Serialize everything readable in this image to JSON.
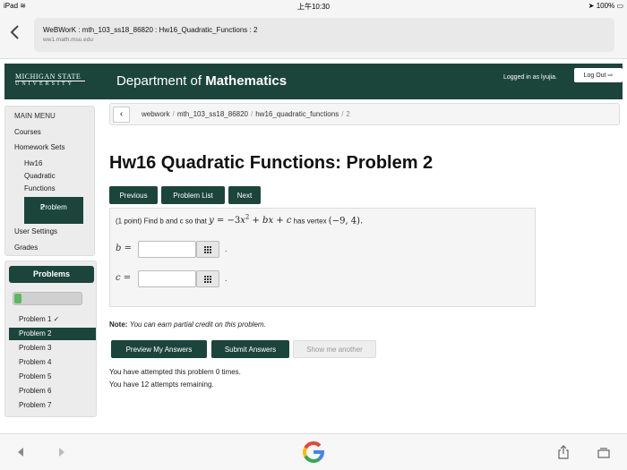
{
  "status_bar": {
    "device": "iPad",
    "time": "上午10:30",
    "battery": "100%"
  },
  "browser": {
    "page_title": "WeBWorK : mth_103_ss18_86820 : Hw16_Quadratic_Functions : 2",
    "url": "ww1.math.msu.edu"
  },
  "header": {
    "logo_line1": "MICHIGAN STATE",
    "logo_line2": "UNIVERSITY",
    "dept_prefix": "Department of ",
    "dept_bold": "Mathematics",
    "logged_in": "Logged in as lyujia.",
    "logout": "Log Out"
  },
  "menu": {
    "heading": "MAIN MENU",
    "courses": "Courses",
    "homework_sets": "Homework Sets",
    "set_name_line1": "Hw16",
    "set_name_line2": "Quadratic",
    "set_name_line3": "Functions",
    "active_line1": "Problem",
    "active_line2": "2",
    "user_settings": "User Settings",
    "grades": "Grades"
  },
  "problems_panel": {
    "heading": "Problems",
    "progress_fraction": 0.1,
    "items": [
      "Problem 1 ✓",
      "Problem 2",
      "Problem 3",
      "Problem 4",
      "Problem 5",
      "Problem 6",
      "Problem 7"
    ],
    "active_index": 1
  },
  "breadcrumb": {
    "items": [
      "webwork",
      "mth_103_ss18_86820",
      "hw16_quadratic_functions"
    ],
    "separator": "/",
    "current": "2"
  },
  "problem": {
    "title": "Hw16 Quadratic Functions: Problem 2",
    "nav": {
      "previous": "Previous",
      "list": "Problem List",
      "next": "Next"
    },
    "statement_prefix": "(1 point) Find b and c so that ",
    "statement_mid": " has vertex ",
    "equation_lhs": "y",
    "equation_eq": " = −3",
    "equation_x": "x",
    "equation_exp": "2",
    "equation_rest": " + bx + c",
    "vertex": "(−9, 4).",
    "answer_b_label": "b =",
    "answer_c_label": "c =",
    "answer_b_value": "",
    "answer_c_value": "",
    "period": "."
  },
  "note": {
    "label": "Note:",
    "text": "You can earn partial credit on this problem."
  },
  "actions": {
    "preview": "Preview My Answers",
    "submit": "Submit Answers",
    "show_another": "Show me another"
  },
  "attempts": {
    "line1": "You have attempted this problem 0 times.",
    "line2": "You have 12 attempts remaining."
  }
}
